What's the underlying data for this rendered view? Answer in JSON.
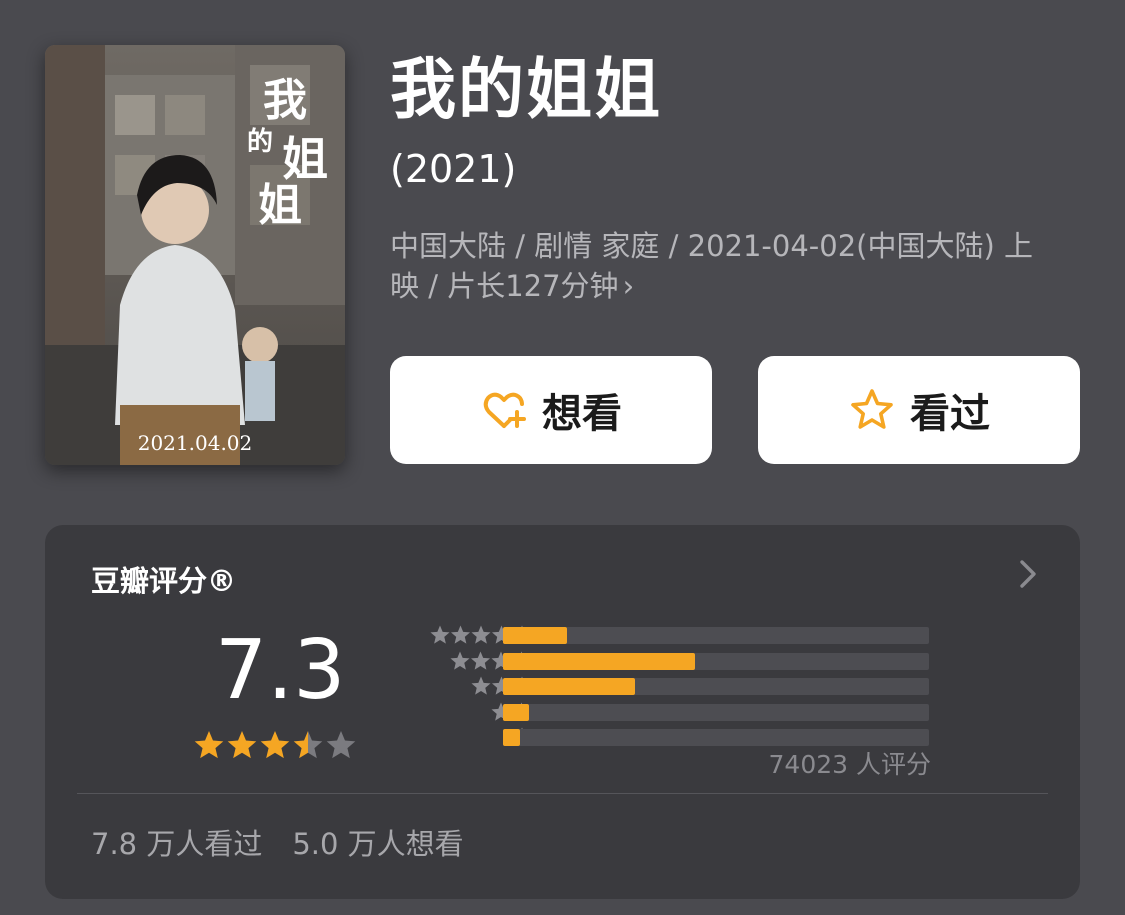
{
  "movie": {
    "title": "我的姐姐",
    "year": "(2021)",
    "meta_line": "中国大陆 / 剧情 家庭 / 2021-04-02(中国大陆) 上映 / 片长127分钟",
    "meta_chevron": "›"
  },
  "poster": {
    "title_text": "我的姐姐",
    "date_text": "2021.04.02"
  },
  "actions": {
    "want_label": "想看",
    "seen_label": "看过",
    "accent_color": "#f5a623"
  },
  "rating": {
    "title": "豆瓣评分®",
    "score": "7.3",
    "score_stars": 3.5,
    "distribution": [
      {
        "stars": 5,
        "percent": 15
      },
      {
        "stars": 4,
        "percent": 45
      },
      {
        "stars": 3,
        "percent": 31
      },
      {
        "stars": 2,
        "percent": 6
      },
      {
        "stars": 1,
        "percent": 4
      }
    ],
    "count_text": "74023 人评分",
    "seen_text": "7.8 万人看过",
    "want_text": "5.0 万人想看"
  }
}
